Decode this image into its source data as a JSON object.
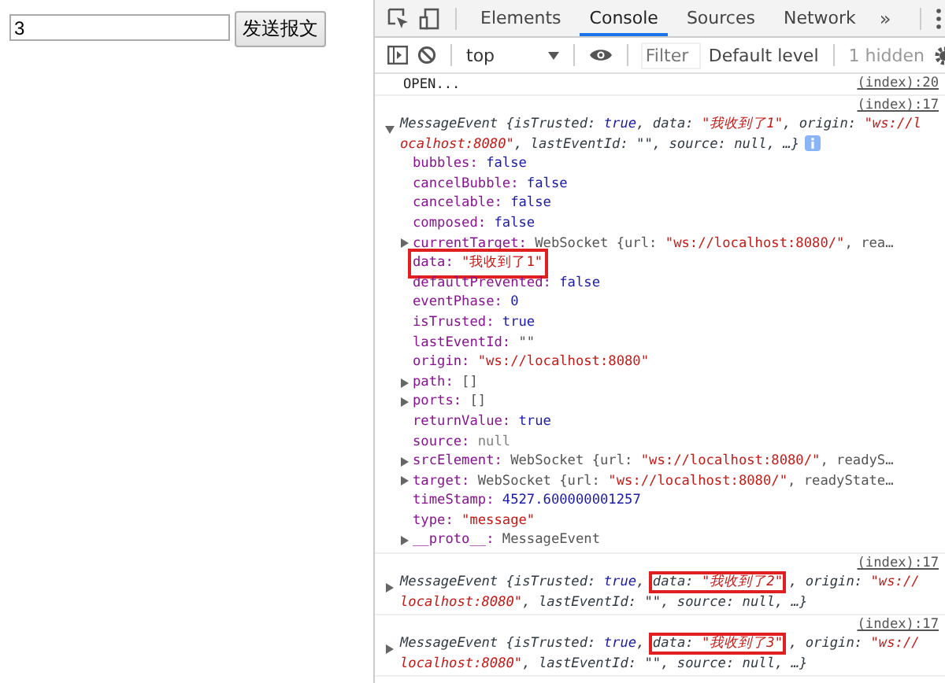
{
  "page": {
    "input": {
      "value": "3"
    },
    "send_button": "发送报文"
  },
  "devtools": {
    "tabs": [
      {
        "label": "Elements",
        "selected": false
      },
      {
        "label": "Console",
        "selected": true
      },
      {
        "label": "Sources",
        "selected": false
      },
      {
        "label": "Network",
        "selected": false
      }
    ],
    "more_tabs": "»",
    "console_toolbar": {
      "context": "top",
      "filter": {
        "placeholder": "Filter"
      },
      "level": "Default level",
      "hidden": "1 hidden"
    },
    "messages": [
      {
        "kind": "log",
        "text": "OPEN...",
        "source": "(index):20"
      },
      {
        "kind": "object",
        "source": "(index):17",
        "expanded": true,
        "boxed": false,
        "summary": [
          {
            "kind": "plain",
            "text": "MessageEvent {isTrusted: "
          },
          {
            "kind": "kw",
            "text": "true"
          },
          {
            "kind": "plain",
            "text": ", "
          },
          {
            "kind": "data",
            "key": "data: ",
            "value": "\"我收到了1\""
          },
          {
            "kind": "plain",
            "text": ", origin: "
          },
          {
            "kind": "str",
            "text": "\"ws://localhost:8080\""
          },
          {
            "kind": "plain",
            "text": ", lastEventId: \"\", source: null, …}"
          }
        ],
        "properties": [
          {
            "key": "bubbles:",
            "expandable": false,
            "boxed": false,
            "value": [
              {
                "kind": "kw",
                "text": "false"
              }
            ]
          },
          {
            "key": "cancelBubble:",
            "expandable": false,
            "boxed": false,
            "value": [
              {
                "kind": "kw",
                "text": "false"
              }
            ]
          },
          {
            "key": "cancelable:",
            "expandable": false,
            "boxed": false,
            "value": [
              {
                "kind": "kw",
                "text": "false"
              }
            ]
          },
          {
            "key": "composed:",
            "expandable": false,
            "boxed": false,
            "value": [
              {
                "kind": "kw",
                "text": "false"
              }
            ]
          },
          {
            "key": "currentTarget:",
            "expandable": true,
            "boxed": false,
            "value": [
              {
                "kind": "obj",
                "text": "WebSocket {url: "
              },
              {
                "kind": "str",
                "text": "\"ws://localhost:8080/\""
              },
              {
                "kind": "obj",
                "text": ", rea…"
              }
            ]
          },
          {
            "key": "data:",
            "expandable": false,
            "boxed": true,
            "value": [
              {
                "kind": "str",
                "text": "\"我收到了1\""
              }
            ]
          },
          {
            "key": "defaultPrevented:",
            "expandable": false,
            "boxed": false,
            "value": [
              {
                "kind": "kw",
                "text": "false"
              }
            ]
          },
          {
            "key": "eventPhase:",
            "expandable": false,
            "boxed": false,
            "value": [
              {
                "kind": "kw",
                "text": "0"
              }
            ]
          },
          {
            "key": "isTrusted:",
            "expandable": false,
            "boxed": false,
            "value": [
              {
                "kind": "kw",
                "text": "true"
              }
            ]
          },
          {
            "key": "lastEventId:",
            "expandable": false,
            "boxed": false,
            "value": [
              {
                "kind": "obj",
                "text": "\"\""
              }
            ]
          },
          {
            "key": "origin:",
            "expandable": false,
            "boxed": false,
            "value": [
              {
                "kind": "str",
                "text": "\"ws://localhost:8080\""
              }
            ]
          },
          {
            "key": "path:",
            "expandable": true,
            "boxed": false,
            "value": [
              {
                "kind": "obj",
                "text": "[]"
              }
            ]
          },
          {
            "key": "ports:",
            "expandable": true,
            "boxed": false,
            "value": [
              {
                "kind": "obj",
                "text": "[]"
              }
            ]
          },
          {
            "key": "returnValue:",
            "expandable": false,
            "boxed": false,
            "value": [
              {
                "kind": "kw",
                "text": "true"
              }
            ]
          },
          {
            "key": "source:",
            "expandable": false,
            "boxed": false,
            "value": [
              {
                "kind": "null",
                "text": "null"
              }
            ]
          },
          {
            "key": "srcElement:",
            "expandable": true,
            "boxed": false,
            "value": [
              {
                "kind": "obj",
                "text": "WebSocket {url: "
              },
              {
                "kind": "str",
                "text": "\"ws://localhost:8080/\""
              },
              {
                "kind": "obj",
                "text": ", readyS…"
              }
            ]
          },
          {
            "key": "target:",
            "expandable": true,
            "boxed": false,
            "value": [
              {
                "kind": "obj",
                "text": "WebSocket {url: "
              },
              {
                "kind": "str",
                "text": "\"ws://localhost:8080/\""
              },
              {
                "kind": "obj",
                "text": ", readyState…"
              }
            ]
          },
          {
            "key": "timeStamp:",
            "expandable": false,
            "boxed": false,
            "value": [
              {
                "kind": "kw",
                "text": "4527.600000001257"
              }
            ]
          },
          {
            "key": "type:",
            "expandable": false,
            "boxed": false,
            "value": [
              {
                "kind": "str",
                "text": "\"message\""
              }
            ]
          },
          {
            "key": "__proto__:",
            "expandable": true,
            "boxed": false,
            "value": [
              {
                "kind": "obj",
                "text": "MessageEvent"
              }
            ]
          }
        ]
      },
      {
        "kind": "object",
        "source": "(index):17",
        "expanded": false,
        "boxed": true,
        "summary": [
          {
            "kind": "plain",
            "text": "MessageEvent {isTrusted: "
          },
          {
            "kind": "kw",
            "text": "true"
          },
          {
            "kind": "plain",
            "text": ", "
          },
          {
            "kind": "data",
            "key": "data: ",
            "value": "\"我收到了2\""
          },
          {
            "kind": "plain",
            "text": ", origin: "
          },
          {
            "kind": "str",
            "text": "\"ws://localhost:8080\""
          },
          {
            "kind": "plain",
            "text": ", lastEventId: \"\", source: null, …}"
          }
        ]
      },
      {
        "kind": "object",
        "source": "(index):17",
        "expanded": false,
        "boxed": true,
        "summary": [
          {
            "kind": "plain",
            "text": "MessageEvent {isTrusted: "
          },
          {
            "kind": "kw",
            "text": "true"
          },
          {
            "kind": "plain",
            "text": ", "
          },
          {
            "kind": "data",
            "key": "data: ",
            "value": "\"我收到了3\""
          },
          {
            "kind": "plain",
            "text": ", origin: "
          },
          {
            "kind": "str",
            "text": "\"ws://localhost:8080\""
          },
          {
            "kind": "plain",
            "text": ", lastEventId: \"\", source: null, …}"
          }
        ]
      }
    ]
  }
}
